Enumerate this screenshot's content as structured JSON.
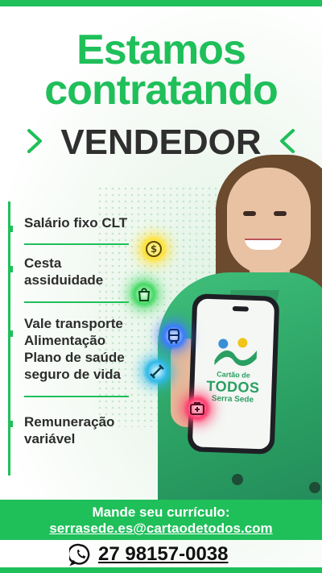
{
  "header": {
    "line1": "Estamos",
    "line2": "contratando",
    "role": "VENDEDOR"
  },
  "benefits": [
    {
      "text": "Salário fixo CLT",
      "icon": "dollar-coin-icon"
    },
    {
      "text": "Cesta\nassiduidade",
      "icon": "shopping-bag-icon"
    },
    {
      "text": "Vale transporte\nAlimentação\nPlano de saúde\nseguro de vida",
      "icon": "bus-icon"
    },
    {
      "text": "Remuneração\nvariável",
      "icon": "medical-kit-icon"
    }
  ],
  "phone_logo": {
    "line1": "Cartão de",
    "line2": "TODOS",
    "line3": "Serra Sede"
  },
  "footer": {
    "cta": "Mande seu currículo:",
    "email": "serrasede.es@cartaodetodos.com",
    "phone": "27 98157-0038",
    "phone_icon": "whatsapp-icon"
  },
  "colors": {
    "brand_green": "#1fbf5a",
    "text_dark": "#2f2f2f"
  }
}
